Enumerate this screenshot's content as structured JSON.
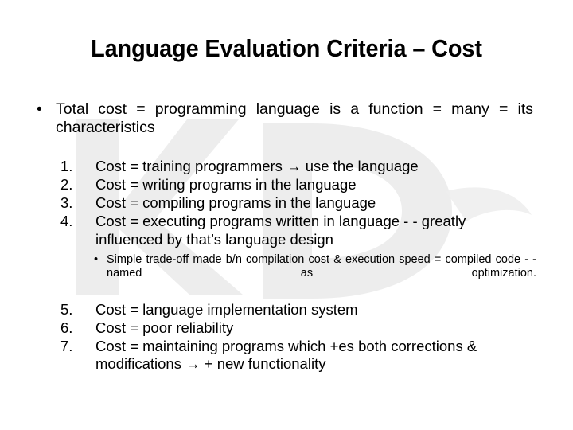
{
  "slide": {
    "title": "Language Evaluation Criteria – Cost",
    "background_color": "#ffffff",
    "text_color": "#000000",
    "watermark_color": "#ededed"
  },
  "content": {
    "bullet_glyph": "•",
    "main_bullet": "Total cost = programming language is a function = many = its characteristics",
    "numbered_items": [
      {
        "number": "1.",
        "text": "Cost = training programmers → use the language"
      },
      {
        "number": "2.",
        "text": "Cost = writing programs in the language"
      },
      {
        "number": "3.",
        "text": "Cost = compiling programs in the language"
      },
      {
        "number": "4.",
        "text": "Cost = executing programs written in language - - greatly influenced by that’s language design"
      },
      {
        "number": "5.",
        "text": "Cost = language implementation system"
      },
      {
        "number": "6.",
        "text": "Cost = poor reliability"
      },
      {
        "number": "7.",
        "text": "Cost = maintaining programs which +es both corrections & modifications → + new functionality"
      }
    ],
    "sub_bullet": {
      "glyph": "•",
      "text": "Simple trade-off made b/n compilation cost & execution speed = compiled code - - named as optimization."
    }
  }
}
